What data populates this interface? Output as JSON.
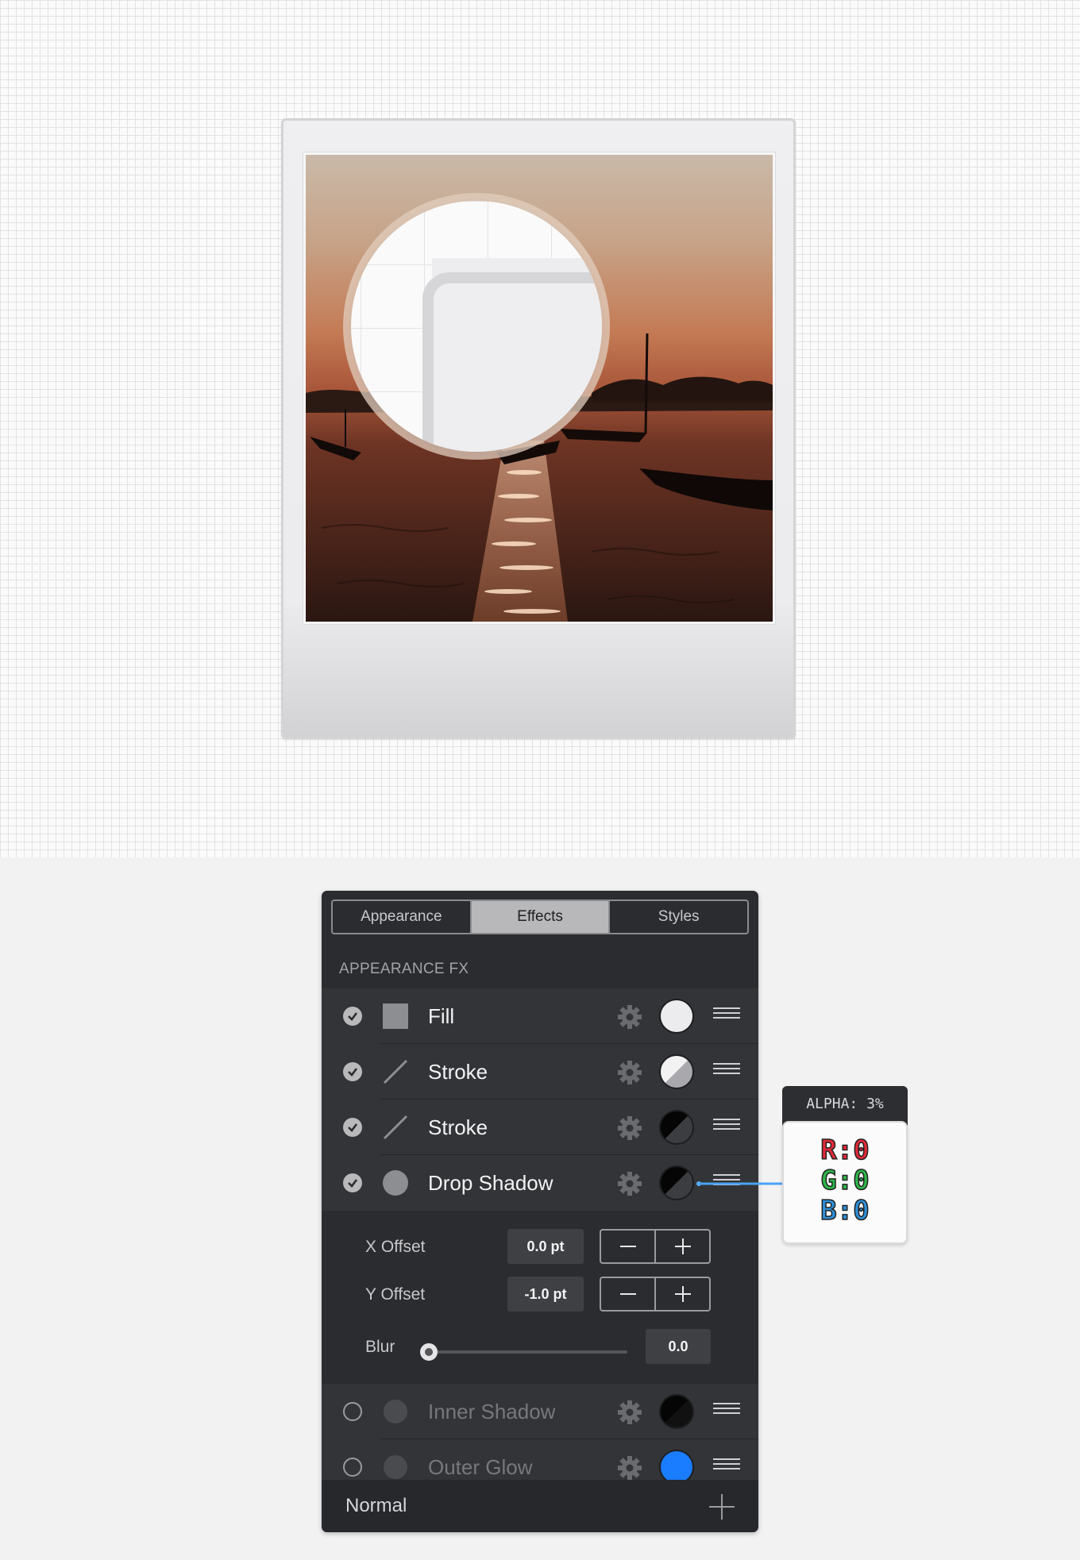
{
  "panel": {
    "tabs": [
      {
        "label": "Appearance",
        "active": false
      },
      {
        "label": "Effects",
        "active": true
      },
      {
        "label": "Styles",
        "active": false
      }
    ],
    "section_title": "APPEARANCE FX",
    "effects": [
      {
        "label": "Fill",
        "enabled": true,
        "icon": "square-fill-icon",
        "swatch": "light-gray"
      },
      {
        "label": "Stroke",
        "enabled": true,
        "icon": "stroke-line-icon",
        "swatch": "half-white-gray"
      },
      {
        "label": "Stroke",
        "enabled": true,
        "icon": "stroke-line-icon",
        "swatch": "half-black"
      },
      {
        "label": "Drop Shadow",
        "enabled": true,
        "icon": "circle-shadow-icon",
        "swatch": "half-black"
      },
      {
        "label": "Inner Shadow",
        "enabled": false,
        "icon": "circle-shadow-icon",
        "swatch": "black"
      },
      {
        "label": "Outer Glow",
        "enabled": false,
        "icon": "circle-shadow-icon",
        "swatch": "#1a7cff"
      }
    ],
    "drop_shadow_settings": {
      "x_offset_label": "X Offset",
      "x_offset_value": "0.0 pt",
      "y_offset_label": "Y Offset",
      "y_offset_value": "-1.0 pt",
      "blur_label": "Blur",
      "blur_value": "0.0",
      "blur_level": 0
    },
    "footer": {
      "blend_mode": "Normal"
    }
  },
  "tooltip": {
    "alpha": "ALPHA: 3%",
    "r": "R:0",
    "g": "G:0",
    "b": "B:0"
  },
  "colors": {
    "panel_bg": "#2b2c2f",
    "red": "#e02a38",
    "green": "#2fb54a",
    "blue": "#2f8fd6",
    "glow_blue": "#1a7cff"
  }
}
